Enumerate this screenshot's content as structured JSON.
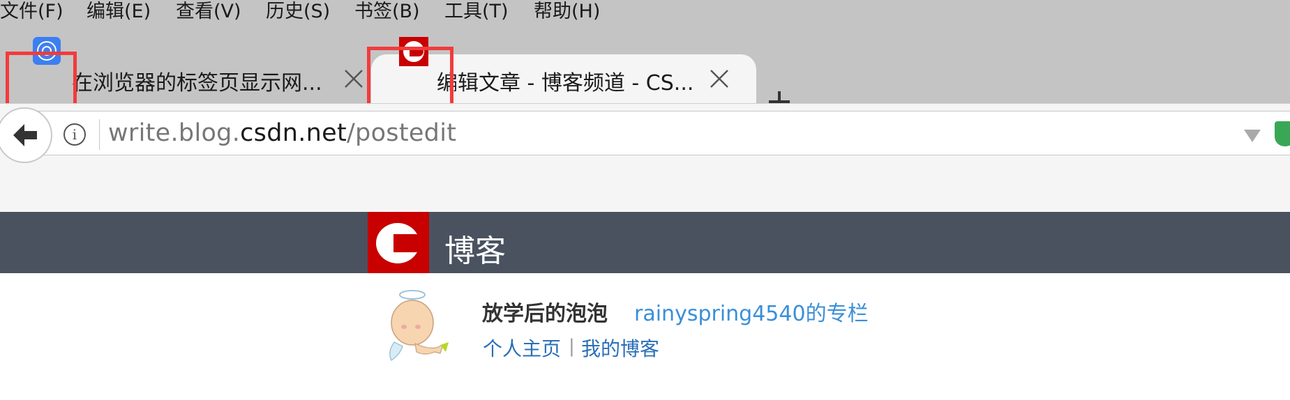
{
  "menubar": {
    "items": [
      "文件(F)",
      "编辑(E)",
      "查看(V)",
      "历史(S)",
      "书签(B)",
      "工具(T)",
      "帮助(H)"
    ]
  },
  "tabs": [
    {
      "title": "在浏览器的标签页显示网...",
      "favicon": "globe-favicon-icon",
      "active": false
    },
    {
      "title": "编辑文章 - 博客频道 - CS...",
      "favicon": "csdn-favicon-icon",
      "active": true
    }
  ],
  "addressbar": {
    "url_prefix": "write.blog.",
    "url_host": "csdn.net",
    "url_path": "/postedit"
  },
  "site": {
    "name": "博客"
  },
  "profile": {
    "name": "放学后的泡泡",
    "column": "rainyspring4540的专栏",
    "home_link": "个人主页",
    "separator": "|",
    "blog_link": "我的博客"
  },
  "colors": {
    "highlight": "#f23b3b",
    "csdn_red": "#c80000",
    "header_bg": "#4a5260",
    "link": "#2a6fb8"
  }
}
